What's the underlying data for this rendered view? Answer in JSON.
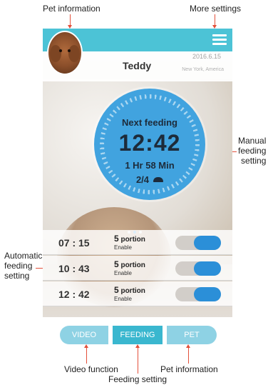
{
  "annotations": {
    "pet_information_top": "Pet information",
    "more_settings": "More settings",
    "manual_feeding_line1": "Manual",
    "manual_feeding_line2": "feeding",
    "manual_feeding_line3": "setting",
    "automatic_feeding_line1": "Automatic",
    "automatic_feeding_line2": "feeding",
    "automatic_feeding_line3": "setting",
    "video_function": "Video function",
    "feeding_setting": "Feeding setting",
    "pet_information_bottom": "Pet information"
  },
  "profile": {
    "name": "Teddy",
    "date": "2016.6.15",
    "location": "New York, America"
  },
  "dial": {
    "title": "Next feeding",
    "time": "12:42",
    "countdown": "1 Hr 58 Min",
    "portions": "2/4"
  },
  "carousel": {
    "page_count": 3,
    "active_index": 1
  },
  "schedule": [
    {
      "time": "07 : 15",
      "portion_num": "5",
      "portion_unit": "portion",
      "status": "Enable",
      "enabled": true
    },
    {
      "time": "10 : 43",
      "portion_num": "5",
      "portion_unit": "portion",
      "status": "Enable",
      "enabled": true
    },
    {
      "time": "12 : 42",
      "portion_num": "5",
      "portion_unit": "portion",
      "status": "Enable",
      "enabled": true
    }
  ],
  "tabs": [
    {
      "label": "VIDEO",
      "active": false
    },
    {
      "label": "FEEDING",
      "active": true
    },
    {
      "label": "PET",
      "active": false
    }
  ],
  "colors": {
    "topbar": "#4cc3d6",
    "dial": "#41a3df",
    "toggle_on": "#2b8fd8",
    "tab_active": "#3ab7cf",
    "tab_inactive": "#8ed2e4",
    "annotation_line": "#e3503a"
  },
  "icons": {
    "menu": "hamburger-icon",
    "portion": "bowl-icon"
  }
}
